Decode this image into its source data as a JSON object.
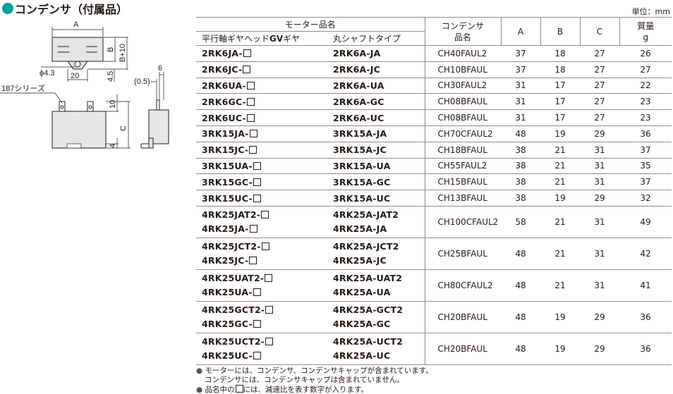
{
  "title": "コンデンサ（付属品）",
  "unit": "単位：mm",
  "drawing": {
    "label_A": "A",
    "label_B": "B",
    "label_B10": "B+10",
    "label_phi": "ϕ4.3",
    "label_20": "20",
    "label_45": "4.5",
    "label_05": "(0.5)",
    "label_6": "6",
    "label_series": "187シリーズ",
    "label_10": "10",
    "label_4": "4",
    "label_C": "C"
  },
  "table": {
    "header": {
      "motor_group": "モーター品名",
      "col_parallel_prefix": "平行軸ギヤヘッド",
      "col_parallel_gv": "GV",
      "col_parallel_suffix": "ギヤ",
      "col_round": "丸シャフトタイプ",
      "capacitor_l1": "コンデンサ",
      "capacitor_l2": "品名",
      "a": "A",
      "b": "B",
      "c": "C",
      "mass_l1": "質量",
      "mass_l2": "g"
    },
    "rows": [
      {
        "p": [
          "2RK6JA-"
        ],
        "r": [
          "2RK6A-JA"
        ],
        "cap": "CH40FAUL2",
        "a": "37",
        "b": "18",
        "c": "27",
        "g": "26"
      },
      {
        "p": [
          "2RK6JC-"
        ],
        "r": [
          "2RK6A-JC"
        ],
        "cap": "CH10BFAUL",
        "a": "37",
        "b": "18",
        "c": "27",
        "g": "27"
      },
      {
        "p": [
          "2RK6UA-"
        ],
        "r": [
          "2RK6A-UA"
        ],
        "cap": "CH30FAUL2",
        "a": "31",
        "b": "17",
        "c": "27",
        "g": "22"
      },
      {
        "p": [
          "2RK6GC-"
        ],
        "r": [
          "2RK6A-GC"
        ],
        "cap": "CH08BFAUL",
        "a": "31",
        "b": "17",
        "c": "27",
        "g": "23"
      },
      {
        "p": [
          "2RK6UC-"
        ],
        "r": [
          "2RK6A-UC"
        ],
        "cap": "CH08BFAUL",
        "a": "31",
        "b": "17",
        "c": "27",
        "g": "23"
      },
      {
        "p": [
          "3RK15JA-"
        ],
        "r": [
          "3RK15A-JA"
        ],
        "cap": "CH70CFAUL2",
        "a": "48",
        "b": "19",
        "c": "29",
        "g": "36"
      },
      {
        "p": [
          "3RK15JC-"
        ],
        "r": [
          "3RK15A-JC"
        ],
        "cap": "CH18BFAUL",
        "a": "38",
        "b": "21",
        "c": "31",
        "g": "37"
      },
      {
        "p": [
          "3RK15UA-"
        ],
        "r": [
          "3RK15A-UA"
        ],
        "cap": "CH55FAUL2",
        "a": "38",
        "b": "21",
        "c": "31",
        "g": "35"
      },
      {
        "p": [
          "3RK15GC-"
        ],
        "r": [
          "3RK15A-GC"
        ],
        "cap": "CH15BFAUL",
        "a": "38",
        "b": "21",
        "c": "31",
        "g": "37"
      },
      {
        "p": [
          "3RK15UC-"
        ],
        "r": [
          "3RK15A-UC"
        ],
        "cap": "CH13BFAUL",
        "a": "38",
        "b": "19",
        "c": "29",
        "g": "32"
      },
      {
        "p": [
          "4RK25JAT2-",
          "4RK25JA-"
        ],
        "r": [
          "4RK25A-JAT2",
          "4RK25A-JA"
        ],
        "cap": "CH100CFAUL2",
        "a": "58",
        "b": "21",
        "c": "31",
        "g": "49"
      },
      {
        "p": [
          "4RK25JCT2-",
          "4RK25JC-"
        ],
        "r": [
          "4RK25A-JCT2",
          "4RK25A-JC"
        ],
        "cap": "CH25BFAUL",
        "a": "48",
        "b": "21",
        "c": "31",
        "g": "42"
      },
      {
        "p": [
          "4RK25UAT2-",
          "4RK25UA-"
        ],
        "r": [
          "4RK25A-UAT2",
          "4RK25A-UA"
        ],
        "cap": "CH80CFAUL2",
        "a": "48",
        "b": "21",
        "c": "31",
        "g": "41"
      },
      {
        "p": [
          "4RK25GCT2-",
          "4RK25GC-"
        ],
        "r": [
          "4RK25A-GCT2",
          "4RK25A-GC"
        ],
        "cap": "CH20BFAUL",
        "a": "48",
        "b": "19",
        "c": "29",
        "g": "36"
      },
      {
        "p": [
          "4RK25UCT2-",
          "4RK25UC-"
        ],
        "r": [
          "4RK25A-UCT2",
          "4RK25A-UC"
        ],
        "cap": "CH20BFAUL",
        "a": "48",
        "b": "19",
        "c": "29",
        "g": "36"
      }
    ]
  },
  "notes": {
    "note1": "モーターには、コンデンサ、コンデンサキャップが含まれています。",
    "note1b": "コンデンサには、コンデンサキャップは含まれていません。",
    "note2_prefix": "品名中の",
    "note2_suffix": "には、減速比を表す数字が入ります。"
  },
  "colors": {
    "accent": "#00a29a",
    "text": "#231815",
    "rule": "#8c8c8c"
  }
}
